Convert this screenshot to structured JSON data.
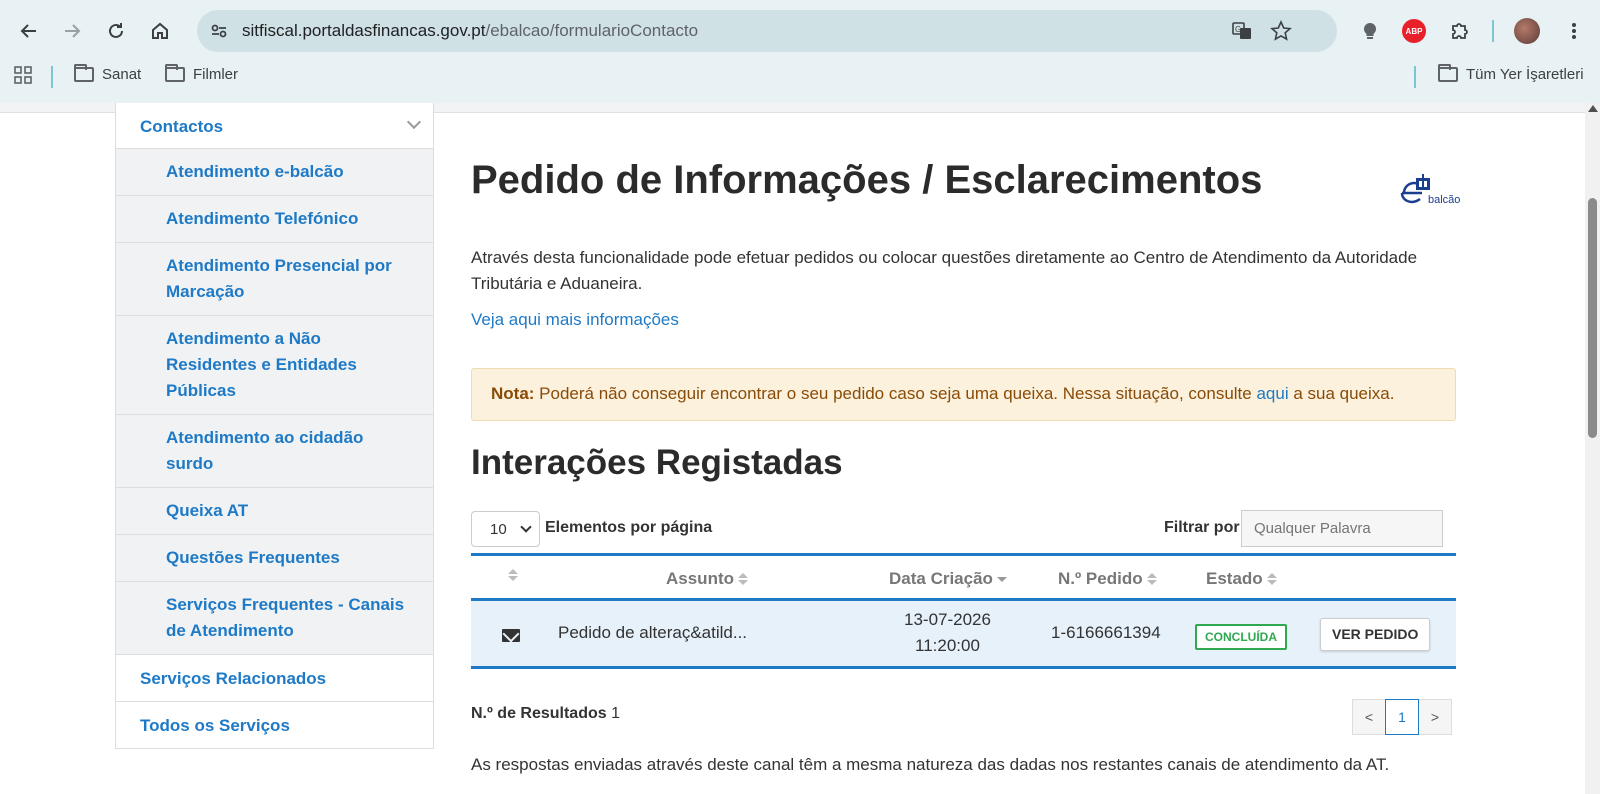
{
  "browser": {
    "url_host": "sitfiscal.portaldasfinancas.gov.pt",
    "url_path": "/ebalcao/formularioContacto",
    "bookmarks": [
      "Sanat",
      "Filmler"
    ],
    "all_bookmarks": "Tüm Yer İşaretleri",
    "abp_label": "ABP"
  },
  "sidebar": {
    "section": "Contactos",
    "items": [
      "Atendimento e-balcão",
      "Atendimento Telefónico",
      "Atendimento Presencial por Marcação",
      "Atendimento a Não Residentes e Entidades Públicas",
      "Atendimento ao cidadão surdo",
      "Queixa AT",
      "Questões Frequentes",
      "Serviços Frequentes - Canais de Atendimento"
    ],
    "bottom": [
      "Serviços Relacionados",
      "Todos os Serviços"
    ]
  },
  "main": {
    "title": "Pedido de Informações / Esclarecimentos",
    "logo_text": "balcão",
    "intro": "Através desta funcionalidade pode efetuar pedidos ou colocar questões diretamente ao Centro de Atendimento da Autoridade Tributária e Aduaneira.",
    "more_link": "Veja aqui mais informações",
    "note_label": "Nota:",
    "note_text_before": " Poderá não conseguir encontrar o seu pedido caso seja uma queixa. Nessa situação, consulte ",
    "note_link": "aqui",
    "note_text_after": " a sua queixa.",
    "section_title": "Interações Registadas",
    "page_size": "10",
    "per_page_label": "Elementos por página",
    "filter_label": "Filtrar por",
    "filter_placeholder": "Qualquer Palavra",
    "columns": [
      "Assunto",
      "Data Criação",
      "N.º Pedido",
      "Estado"
    ],
    "rows": [
      {
        "subject": "Pedido de alteraç&atild...",
        "date": "13-07-2026",
        "time": "11:20:00",
        "number": "1-6166661394",
        "status": "CONCLUÍDA",
        "action": "VER PEDIDO"
      }
    ],
    "results_label": "N.º de Resultados",
    "results_count": "1",
    "pagination": [
      "<",
      "1",
      ">"
    ],
    "footer": "As respostas enviadas através deste canal têm a mesma natureza das dadas nos restantes canais de atendimento da AT."
  },
  "colors": {
    "link": "#1e7ac6",
    "note_bg": "#fbf1dc",
    "note_text": "#8a4b08",
    "status_green": "#2fa84f"
  }
}
